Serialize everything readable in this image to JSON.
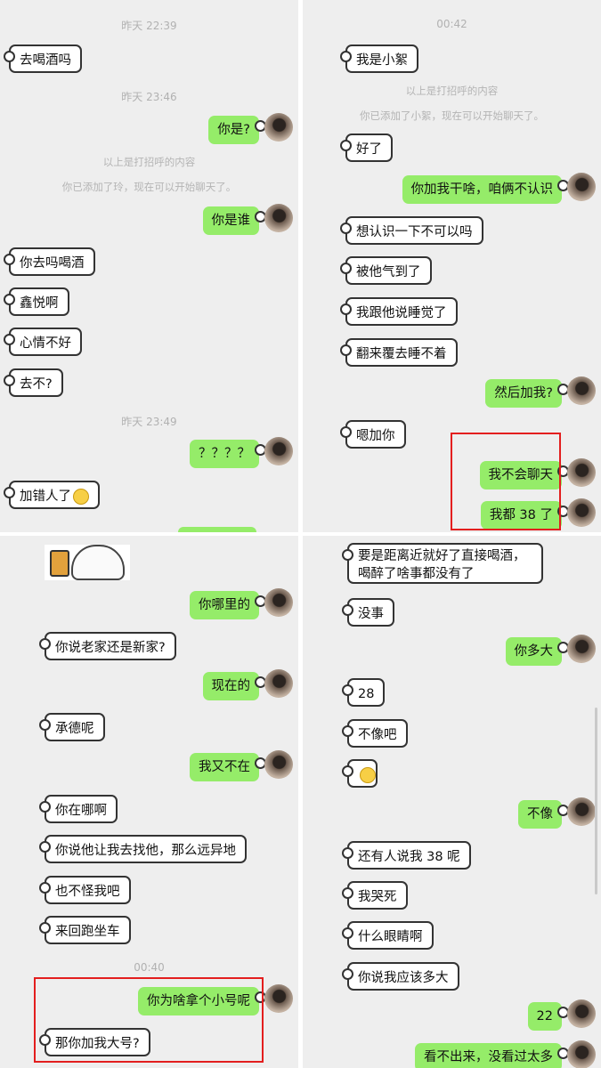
{
  "top_left": {
    "timestamps": [
      "昨天 22:39",
      "昨天 23:46",
      "昨天 23:49"
    ],
    "system": [
      "以上是打招呼的内容",
      "你已添加了玲，现在可以开始聊天了。"
    ],
    "messages": [
      "去喝酒吗",
      "你是?",
      "你是谁",
      "你去吗喝酒",
      "鑫悦啊",
      "心情不好",
      "去不?",
      "？？？？",
      "加错人了"
    ]
  },
  "top_right": {
    "timestamps": [
      "00:42"
    ],
    "system": [
      "以上是打招呼的内容",
      "你已添加了小絮，现在可以开始聊天了。"
    ],
    "messages": [
      "我是小絮",
      "好了",
      "你加我干啥，咱俩不认识",
      "想认识一下不可以吗",
      "被他气到了",
      "我跟他说睡觉了",
      "翻来覆去睡不着",
      "然后加我?",
      "嗯加你",
      "我不会聊天",
      "我都 38 了"
    ]
  },
  "bottom_left": {
    "timestamps": [
      "00:40"
    ],
    "messages": [
      "你哪里的",
      "你说老家还是新家?",
      "现在的",
      "承德呢",
      "我又不在",
      "你在哪啊",
      "你说他让我去找他，那么远异地",
      "也不怪我吧",
      "来回跑坐车",
      "你为啥拿个小号呢",
      "那你加我大号?"
    ]
  },
  "bottom_right": {
    "messages": [
      "要是距离近就好了直接喝酒，喝醉了啥事都没有了",
      "没事",
      "你多大",
      "28",
      "不像吧",
      "不像",
      "还有人说我 38 呢",
      "我哭死",
      "什么眼睛啊",
      "你说我应该多大",
      "22",
      "看不出来，没看过太多"
    ]
  },
  "colors": {
    "outgoing": "#95ec69",
    "incoming": "#ffffff",
    "highlight_box": "#e31e1e",
    "chat_bg": "#eeeeee"
  },
  "icons": {
    "avatar": "contact-avatar",
    "emoji": "awkward-smile-emoji",
    "emoji2": "thinking-emoji",
    "sticker": "bunny-beer-sticker"
  }
}
